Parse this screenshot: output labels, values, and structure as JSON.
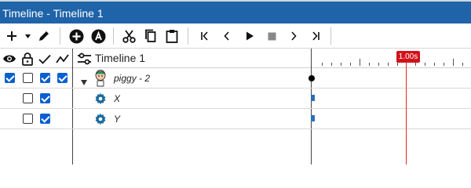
{
  "window": {
    "title": "Timeline - Timeline 1"
  },
  "timeline": {
    "name": "Timeline 1",
    "playhead_label": "1.00s",
    "tracks": [
      {
        "name": "piggy - 2",
        "visible": true,
        "locked": false,
        "checked": true,
        "graph": true
      },
      {
        "name": "X",
        "locked": false,
        "checked": true
      },
      {
        "name": "Y",
        "locked": false,
        "checked": true
      }
    ]
  },
  "colors": {
    "titlebar": "#1f63a8",
    "accent": "#0a5fd0",
    "playhead": "#e0282a",
    "keyframe": "#2a6ebd"
  }
}
